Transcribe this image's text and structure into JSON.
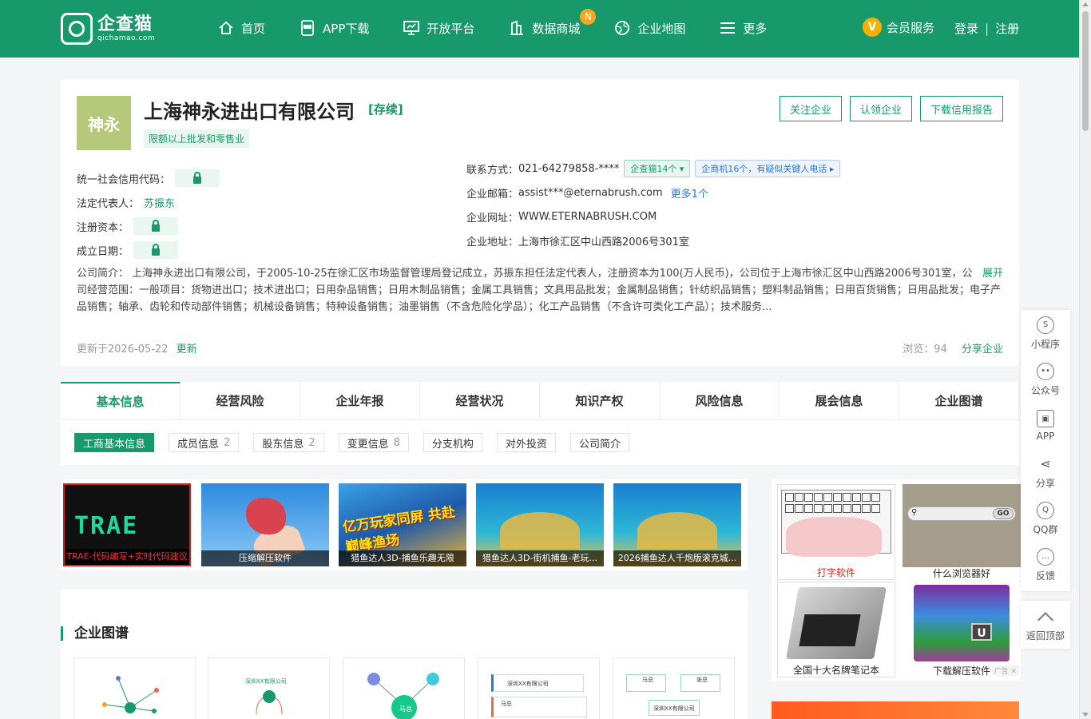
{
  "header": {
    "logo_cn": "企查猫",
    "logo_en": "qichamao.com",
    "nav": [
      {
        "label": "首页",
        "icon": "home-icon"
      },
      {
        "label": "APP下载",
        "icon": "app-icon"
      },
      {
        "label": "开放平台",
        "icon": "monitor-icon"
      },
      {
        "label": "数据商城",
        "icon": "building-icon",
        "badge": "N"
      },
      {
        "label": "企业地图",
        "icon": "globe-icon"
      },
      {
        "label": "更多",
        "icon": "menu-icon"
      }
    ],
    "vip_icon": "V",
    "vip_label": "会员服务",
    "login": "登录",
    "sep": "|",
    "register": "注册"
  },
  "company": {
    "logo_text": "神永",
    "name": "上海神永进出口有限公司",
    "status": "[存续]",
    "tag": "限额以上批发和零售业",
    "actions": [
      "关注企业",
      "认领企业",
      "下载信用报告"
    ],
    "credit_code_label": "统一社会信用代码：",
    "legal_rep_label": "法定代表人：",
    "legal_rep": "苏振东",
    "capital_label": "注册资本：",
    "founded_label": "成立日期：",
    "phone_label": "联系方式：",
    "phone": "021-64279858-****",
    "phone_chip": "企查猫14个",
    "phone_chip2": "企商机16个，有疑似关键人电话",
    "email_label": "企业邮箱：",
    "email": "assist***@eternabrush.com",
    "email_more": "更多1个",
    "website_label": "企业网址：",
    "website": "WWW.ETERNABRUSH.COM",
    "address_label": "企业地址：",
    "address": "上海市徐汇区中山西路2006号301室",
    "intro": "公司简介： 上海神永进出口有限公司，于2005-10-25在徐汇区市场监督管理局登记成立，苏振东担任法定代表人，注册资本为100(万人民币)，公司位于上海市徐汇区中山西路2006号301室，公司经营范围：一般项目：货物进出口；技术进出口；日用杂品销售；日用木制品销售；金属工具销售；文具用品批发；金属制品销售；针纺织品销售；塑料制品销售；日用百货销售；日用品批发；电子产品销售；轴承、齿轮和传动部件销售；机械设备销售；特种设备销售；油墨销售（不含危险化学品）；化工产品销售（不含许可类化工产品）；技术服务...",
    "intro_expand": "展开",
    "updated": "更新于2026-05-22",
    "update_link": "更新",
    "views": "浏览：94",
    "share": "分享企业"
  },
  "tabs": [
    "基本信息",
    "经营风险",
    "企业年报",
    "经营状况",
    "知识产权",
    "风险信息",
    "展会信息",
    "企业图谱"
  ],
  "subtabs": [
    {
      "label": "工商基本信息",
      "count": ""
    },
    {
      "label": "成员信息",
      "count": "2"
    },
    {
      "label": "股东信息",
      "count": "2"
    },
    {
      "label": "变更信息",
      "count": "8"
    },
    {
      "label": "分支机构",
      "count": ""
    },
    {
      "label": "对外投资",
      "count": ""
    },
    {
      "label": "公司简介",
      "count": ""
    }
  ],
  "ads": {
    "a1_logo": "TRAE",
    "a1": "TRAE-代码编写+实时代码建议",
    "a2": "压缩解压软件",
    "a3_title": "亿万玩家同屏 共赴巅峰渔场",
    "a3": "猎鱼达人3D-捕鱼乐趣无限",
    "a4": "猎鱼达人3D-街机捕鱼-老玩...",
    "a5": "2026捕鱼达人千炮版滚克城...",
    "r1": "打字软件",
    "r2": "什么浏览器好",
    "r2_go": "GO",
    "r3": "全国十大名牌笔记本",
    "r4": "下载解压软件",
    "ad_label": "广告"
  },
  "graph": {
    "title": "企业图谱",
    "c2_company": "深圳XX有限公司",
    "c4_company": "深圳XX有限公司",
    "c4_person": "马总",
    "c5_a": "马总",
    "c5_b": "张总",
    "c5_company": "深圳XX有限公司",
    "c3_center": "马总"
  },
  "sidebar": {
    "items": [
      {
        "label": "小程序",
        "icon": "miniapp-icon"
      },
      {
        "label": "公众号",
        "icon": "wechat-icon"
      },
      {
        "label": "APP",
        "icon": "app-icon"
      },
      {
        "label": "分享",
        "icon": "share-icon"
      },
      {
        "label": "QQ群",
        "icon": "qq-icon"
      },
      {
        "label": "反馈",
        "icon": "feedback-icon"
      }
    ],
    "back_top": "返回顶部"
  },
  "colors": {
    "brand": "#17996c",
    "link": "#2e75d6",
    "badge": "#f5a623"
  }
}
